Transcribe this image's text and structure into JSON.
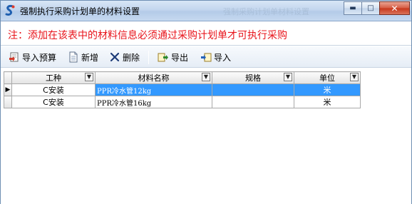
{
  "window": {
    "title": "强制执行采购计划单的材料设置",
    "background_title": "强制采购计划单材料设置",
    "controls": {
      "minimize": "▬",
      "maximize": "□",
      "close": "✕"
    }
  },
  "notice": {
    "text": "注：添加在该表中的材料信息必须通过采购计划单才可执行采购",
    "color": "#e8141b"
  },
  "toolbar": {
    "items": [
      {
        "label": "导入预算",
        "icon": "import-budget-icon"
      },
      {
        "label": "新增",
        "icon": "new-document-icon"
      },
      {
        "label": "删除",
        "icon": "delete-x-icon"
      },
      {
        "label": "导出",
        "icon": "export-icon"
      },
      {
        "label": "导入",
        "icon": "import-icon"
      }
    ]
  },
  "grid": {
    "columns": [
      "工种",
      "材料名称",
      "规格",
      "单位"
    ],
    "filter_glyph": "▼",
    "current_row_marker": "▶",
    "selection_color": "#3399ff",
    "rows": [
      {
        "trade": "C安装",
        "material": "PPR冷水管12kg",
        "spec": "",
        "unit": "米"
      },
      {
        "trade": "C安装",
        "material": "PPR冷水管16kg",
        "spec": "",
        "unit": "米"
      }
    ]
  }
}
